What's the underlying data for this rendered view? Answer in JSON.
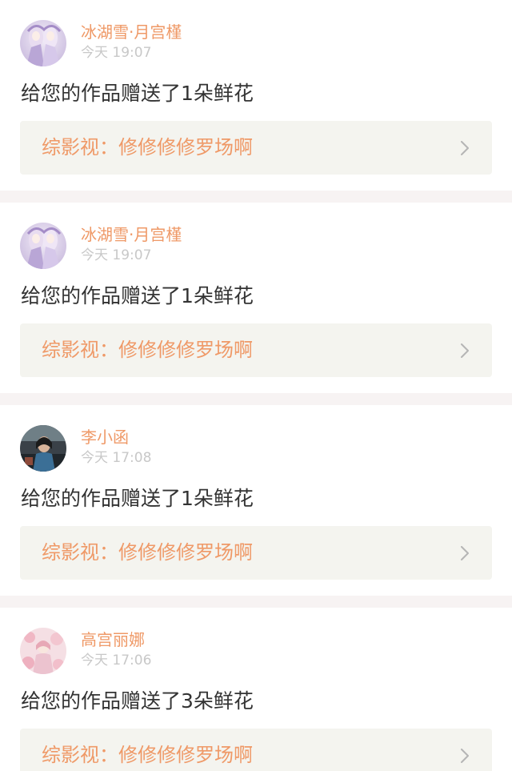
{
  "notifications": [
    {
      "user": "冰湖雪·月宫槿",
      "time": "今天 19:07",
      "message": "给您的作品赠送了1朵鲜花",
      "work": "综影视：修修修修罗场啊"
    },
    {
      "user": "冰湖雪·月宫槿",
      "time": "今天 19:07",
      "message": "给您的作品赠送了1朵鲜花",
      "work": "综影视：修修修修罗场啊"
    },
    {
      "user": "李小函",
      "time": "今天 17:08",
      "message": "给您的作品赠送了1朵鲜花",
      "work": "综影视：修修修修罗场啊"
    },
    {
      "user": "高宫丽娜",
      "time": "今天 17:06",
      "message": "给您的作品赠送了3朵鲜花",
      "work": "综影视：修修修修罗场啊"
    }
  ],
  "colors": {
    "accent": "#ef9967",
    "time": "#c8c8c8",
    "text": "#333333",
    "link_bg": "#f4f4ef",
    "divider": "#f7f3f3"
  },
  "icons": {
    "chevron": "chevron-right-icon"
  }
}
